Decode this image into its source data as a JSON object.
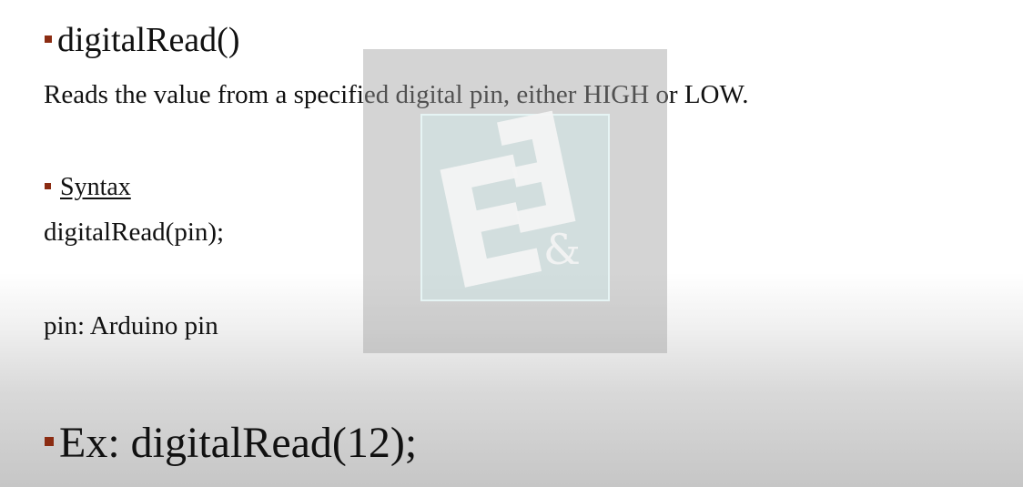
{
  "slide": {
    "heading": "digitalRead()",
    "description": "Reads the value from a specified digital pin, either HIGH or LOW.",
    "syntax_label": "Syntax",
    "syntax_code": "digitalRead(pin);",
    "parameter": "pin: Arduino pin",
    "example": "Ex: digitalRead(12);"
  },
  "colors": {
    "bullet": "#8b2c12",
    "text": "#111111",
    "logo_tint": "#d8ecec"
  },
  "watermark": {
    "logo_text": "E3&",
    "icon": "e3-logo-icon"
  }
}
